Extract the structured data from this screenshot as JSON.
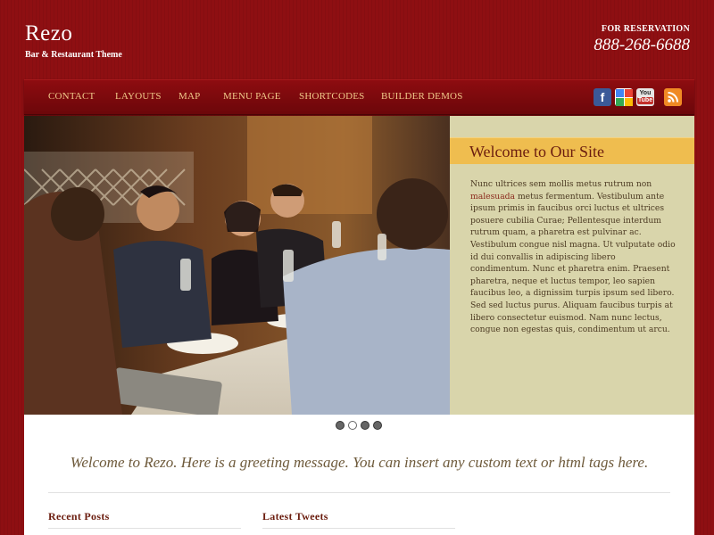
{
  "header": {
    "title": "Rezo",
    "tagline": "Bar & Restaurant Theme",
    "reservation_label": "FOR RESERVATION",
    "phone": "888-268-6688"
  },
  "nav": {
    "items": [
      {
        "label": "CONTACT"
      },
      {
        "label": "LAYOUTS"
      },
      {
        "label": "MAP"
      },
      {
        "label": "MENU PAGE"
      },
      {
        "label": "SHORTCODES"
      },
      {
        "label": "BUILDER DEMOS"
      }
    ],
    "social": [
      {
        "icon": "facebook-icon",
        "glyph": "f",
        "color": "#3b5998"
      },
      {
        "icon": "google-icon",
        "color": "#ffffff"
      },
      {
        "icon": "youtube-icon",
        "text_top": "You",
        "text_bottom": "Tube",
        "color": "#c4302b"
      },
      {
        "icon": "rss-icon",
        "color": "#f08a24"
      }
    ]
  },
  "hero": {
    "welcome_title": "Welcome to Our Site",
    "body_before_link": "Nunc ultrices sem mollis metus rutrum non",
    "link_text": "malesuada",
    "body_after_link": "metus fermentum. Vestibulum ante ipsum primis in faucibus orci luctus et ultrices posuere cubilia Curae; Pellentesque interdum rutrum quam, a pharetra est pulvinar ac. Vestibulum congue nisl magna. Ut vulputate odio id dui convallis in adipiscing libero condimentum. Nunc et pharetra enim. Praesent pharetra, neque et luctus tempor, leo sapien faucibus leo, a dignissim turpis ipsum sed libero. Sed sed luctus purus. Aliquam faucibus turpis at libero consectetur euismod. Nam nunc lectus, congue non egestas quis, condimentum ut arcu.",
    "slider_count": 4,
    "active_slide": 2
  },
  "content": {
    "greeting": "Welcome to Rezo. Here is a greeting message. You can insert any custom text or html tags here.",
    "recent_posts_heading": "Recent Posts",
    "latest_tweets_heading": "Latest Tweets"
  },
  "colors": {
    "background": "#8e0f12",
    "nav_text": "#f0c98a",
    "welcome_bar": "#efbd4f",
    "welcome_panel": "#d9d5ab",
    "heading_red": "#6b1d0f"
  }
}
